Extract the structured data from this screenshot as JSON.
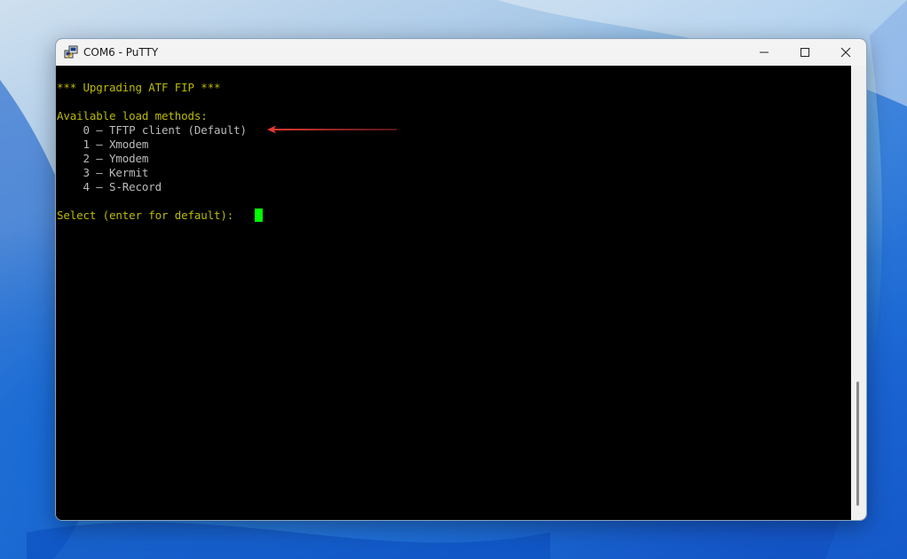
{
  "window": {
    "title": "COM6 - PuTTY",
    "controls": {
      "minimize_icon": "minimize-icon",
      "maximize_icon": "maximize-icon",
      "close_icon": "close-icon"
    }
  },
  "terminal": {
    "text_color": "#bbbb00",
    "cursor_color": "#00ff00",
    "lines": {
      "heading": "*** Upgrading ATF FIP ***",
      "methods_header": "Available load methods:",
      "option_0": "    0 – TFTP client (Default)",
      "option_1": "    1 – Xmodem",
      "option_2": "    2 – Ymodem",
      "option_3": "    3 – Kermit",
      "option_4": "    4 – S-Record",
      "prompt": "Select (enter for default): "
    }
  },
  "annotation": {
    "arrow_color": "#e53935",
    "arrow_icon": "left-arrow-icon"
  }
}
